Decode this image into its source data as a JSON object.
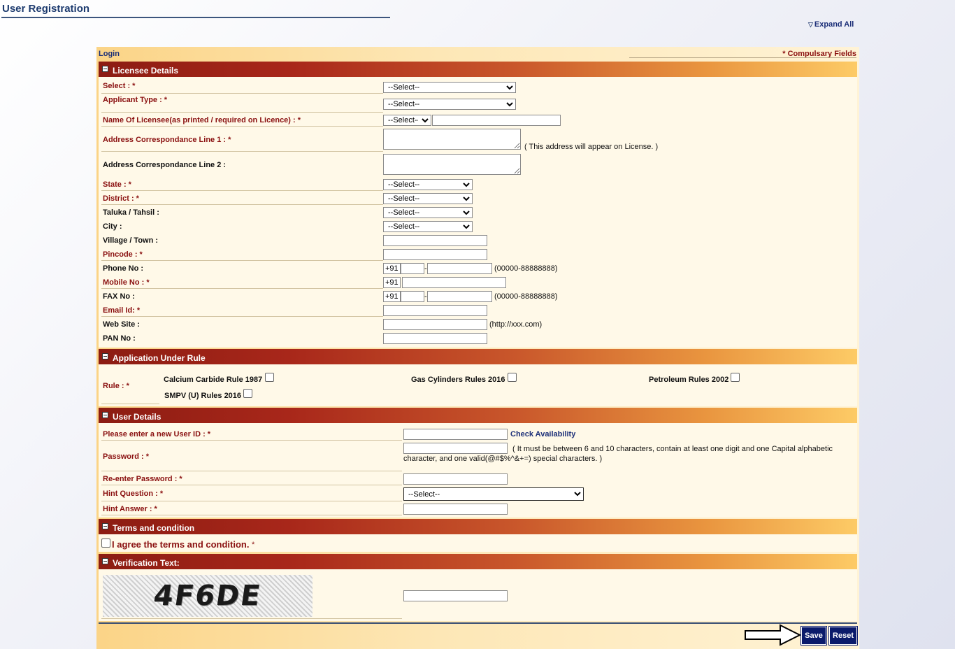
{
  "page": {
    "title": "User Registration",
    "expand_all": "Expand All"
  },
  "top": {
    "login": "Login",
    "compulsory": "* Compulsary Fields"
  },
  "sections": {
    "licensee": "Licensee Details",
    "rule": "Application Under Rule",
    "user": "User Details",
    "terms": "Terms and condition",
    "verification": "Verification Text:"
  },
  "licensee": {
    "select_lbl": "Select : *",
    "applicant_lbl": "Applicant Type : *",
    "name_lbl": "Name Of Licensee(as printed / required on Licence) : *",
    "addr1_lbl": "Address Correspondance Line 1 : *",
    "addr1_hint": "( This address will appear on License. )",
    "addr2_lbl": "Address Correspondance Line 2 :",
    "state_lbl": "State : *",
    "district_lbl": "District : *",
    "taluka_lbl": "Taluka / Tahsil :",
    "city_lbl": "City :",
    "village_lbl": "Village / Town :",
    "pincode_lbl": "Pincode : *",
    "phone_lbl": "Phone No :",
    "mobile_lbl": "Mobile No : *",
    "fax_lbl": "FAX No :",
    "email_lbl": "Email Id: *",
    "web_lbl": "Web Site :",
    "pan_lbl": "PAN No :",
    "select_default": "--Select--",
    "country_code": "+91",
    "phone_hint": "(00000-88888888)",
    "web_hint": "(http://xxx.com)",
    "dash": "-"
  },
  "rule": {
    "lbl": "Rule : *",
    "options": [
      "Calcium Carbide Rule 1987",
      "Gas Cylinders Rules 2016",
      "Petroleum Rules 2002",
      "SMPV (U) Rules 2016"
    ]
  },
  "user": {
    "userid_lbl": "Please enter a new User ID : *",
    "check": "Check Availability",
    "password_lbl": "Password : *",
    "password_hint": "( It must be between 6 and 10 characters, contain at least one digit and one Capital alphabetic character, and one valid(@#$%^&+=) special characters. )",
    "repass_lbl": "Re-enter Password : *",
    "hintq_lbl": "Hint Question : *",
    "hinta_lbl": "Hint Answer : *"
  },
  "terms": {
    "agree": "I agree the terms and condition.",
    "star": "*"
  },
  "verification": {
    "captcha": "4F6DE"
  },
  "buttons": {
    "save": "Save",
    "reset": "Reset"
  }
}
